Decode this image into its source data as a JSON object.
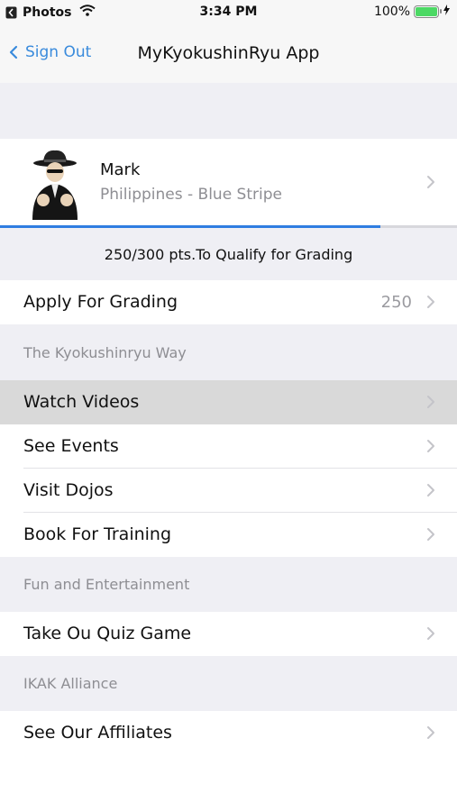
{
  "status_bar": {
    "back_app": "Photos",
    "time": "3:34 PM",
    "battery": "100%"
  },
  "nav": {
    "back_label": "Sign Out",
    "title": "MyKyokushinRyu App"
  },
  "profile": {
    "name": "Mark",
    "subtitle": "Philippines - Blue Stripe"
  },
  "progress": {
    "current": 250,
    "required": 300,
    "fraction": 0.8333,
    "label": "250/300 pts.To Qualify for Grading"
  },
  "grading": {
    "label": "Apply For Grading",
    "value": "250"
  },
  "sections": [
    {
      "header": "The Kyokushinryu Way",
      "items": [
        "Watch Videos",
        "See Events",
        "Visit Dojos",
        "Book For Training"
      ]
    },
    {
      "header": "Fun and Entertainment",
      "items": [
        "Take Ou Quiz Game"
      ]
    },
    {
      "header": "IKAK Alliance",
      "items": [
        "See Our Affiliates"
      ]
    }
  ],
  "highlighted_item": "Watch Videos",
  "colors": {
    "accent": "#3a8bdc",
    "progress": "#2f7de1",
    "group_background": "#efeff4",
    "highlight": "#d9d9d9"
  },
  "icons": [
    "back-chevron-icon",
    "wifi-icon",
    "battery-icon",
    "charging-icon",
    "chevron-right-icon",
    "avatar"
  ]
}
